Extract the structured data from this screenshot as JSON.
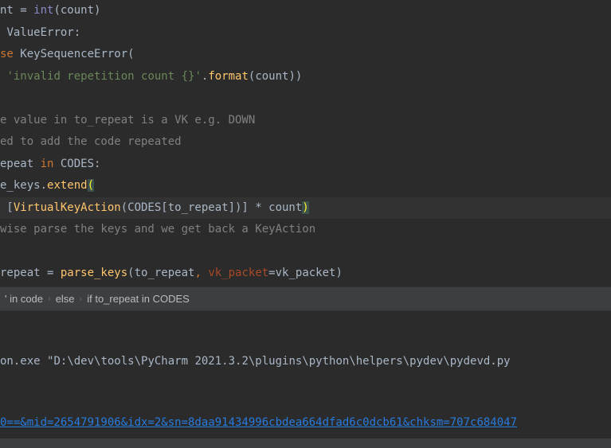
{
  "code": {
    "line1_pre": "nt = ",
    "line1_builtin": "int",
    "line1_post": "(count)",
    "line2_sp": " ",
    "line2_exc": "ValueError",
    "line2_colon": ":",
    "line3_kw": "se ",
    "line3_text": "KeySequenceError(",
    "line4_sp": " ",
    "line4_str": "'invalid repetition count {}'",
    "line4_dot": ".",
    "line4_method": "format",
    "line4_post": "(count))",
    "line6_comment": "e value in to_repeat is a VK e.g. DOWN",
    "line7_comment": "ed to add the code repeated",
    "line8_pre": "epeat ",
    "line8_kw": "in ",
    "line8_post": "CODES:",
    "line9_pre": "e_keys.",
    "line9_method": "extend",
    "line9_bracket": "(",
    "line10_pre": " [",
    "line10_method": "VirtualKeyAction",
    "line10_post": "(CODES[to_repeat])] * count",
    "line10_bracket": ")",
    "line11_comment": "wise parse the keys and we get back a KeyAction",
    "line13_pre": "repeat = ",
    "line13_method": "parse_keys",
    "line13_mid1": "(to_repeat",
    "line13_comma": ", ",
    "line13_param": "vk_packet",
    "line13_mid2": "=vk_packet)"
  },
  "breadcrumb": {
    "item1": "' in code",
    "item2": "else",
    "item3": "if to_repeat in CODES"
  },
  "console": {
    "path_pre": "on.exe ",
    "path": "\"D:\\dev\\tools\\PyCharm 2021.3.2\\plugins\\python\\helpers\\pydev\\pydevd.py",
    "link": "0==&mid=2654791906&idx=2&sn=8daa91434996cbdea664dfad6c0dcb61&chksm=707c684047"
  }
}
